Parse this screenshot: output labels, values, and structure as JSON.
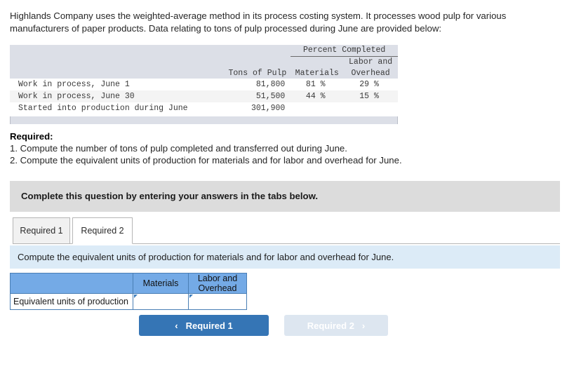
{
  "intro": {
    "paragraph": "Highlands Company uses the weighted-average method in its process costing system. It processes wood pulp for various manufacturers of paper products. Data relating to tons of pulp processed during June are provided below:"
  },
  "data_table": {
    "group_header": "Percent Completed",
    "columns": {
      "blank": "",
      "tons": "Tons of Pulp",
      "materials": "Materials",
      "labor_overhead_line1": "Labor and",
      "labor_overhead_line2": "Overhead"
    },
    "rows": [
      {
        "label": "Work in process, June 1",
        "tons": "81,800",
        "materials": "81 %",
        "labor_overhead": "29 %"
      },
      {
        "label": "Work in process, June 30",
        "tons": "51,500",
        "materials": "44 %",
        "labor_overhead": "15 %"
      },
      {
        "label": "Started into production during June",
        "tons": "301,900",
        "materials": "",
        "labor_overhead": ""
      }
    ]
  },
  "required": {
    "title": "Required:",
    "item1": "1. Compute the number of tons of pulp completed and transferred out during June.",
    "item2": "2. Compute the equivalent units of production for materials and for labor and overhead for June."
  },
  "gray_banner": {
    "text": "Complete this question by entering your answers in the tabs below."
  },
  "tabs": [
    {
      "label": "Required 1",
      "active": false
    },
    {
      "label": "Required 2",
      "active": true
    }
  ],
  "blue_strip": {
    "text": "Compute the equivalent units of production for materials and for labor and overhead for June."
  },
  "answer_table": {
    "headers": {
      "blank": "",
      "materials": "Materials",
      "labor_overhead_line1": "Labor and",
      "labor_overhead_line2": "Overhead"
    },
    "rows": [
      {
        "label": "Equivalent units of production",
        "materials_value": "",
        "labor_overhead_value": ""
      }
    ]
  },
  "nav": {
    "prev_label": "Required 1",
    "prev_icon": "chevron-left-icon",
    "prev_glyph": "‹",
    "next_label": "Required 2",
    "next_icon": "chevron-right-icon",
    "next_glyph": "›"
  },
  "colors": {
    "accent_blue": "#3575b5",
    "table_header_blue": "#74aae6",
    "strip_blue": "#dcebf7",
    "banner_gray": "#dcdcdc",
    "data_header_gray": "#dcdfe7",
    "disabled_button": "#dde6f0"
  }
}
